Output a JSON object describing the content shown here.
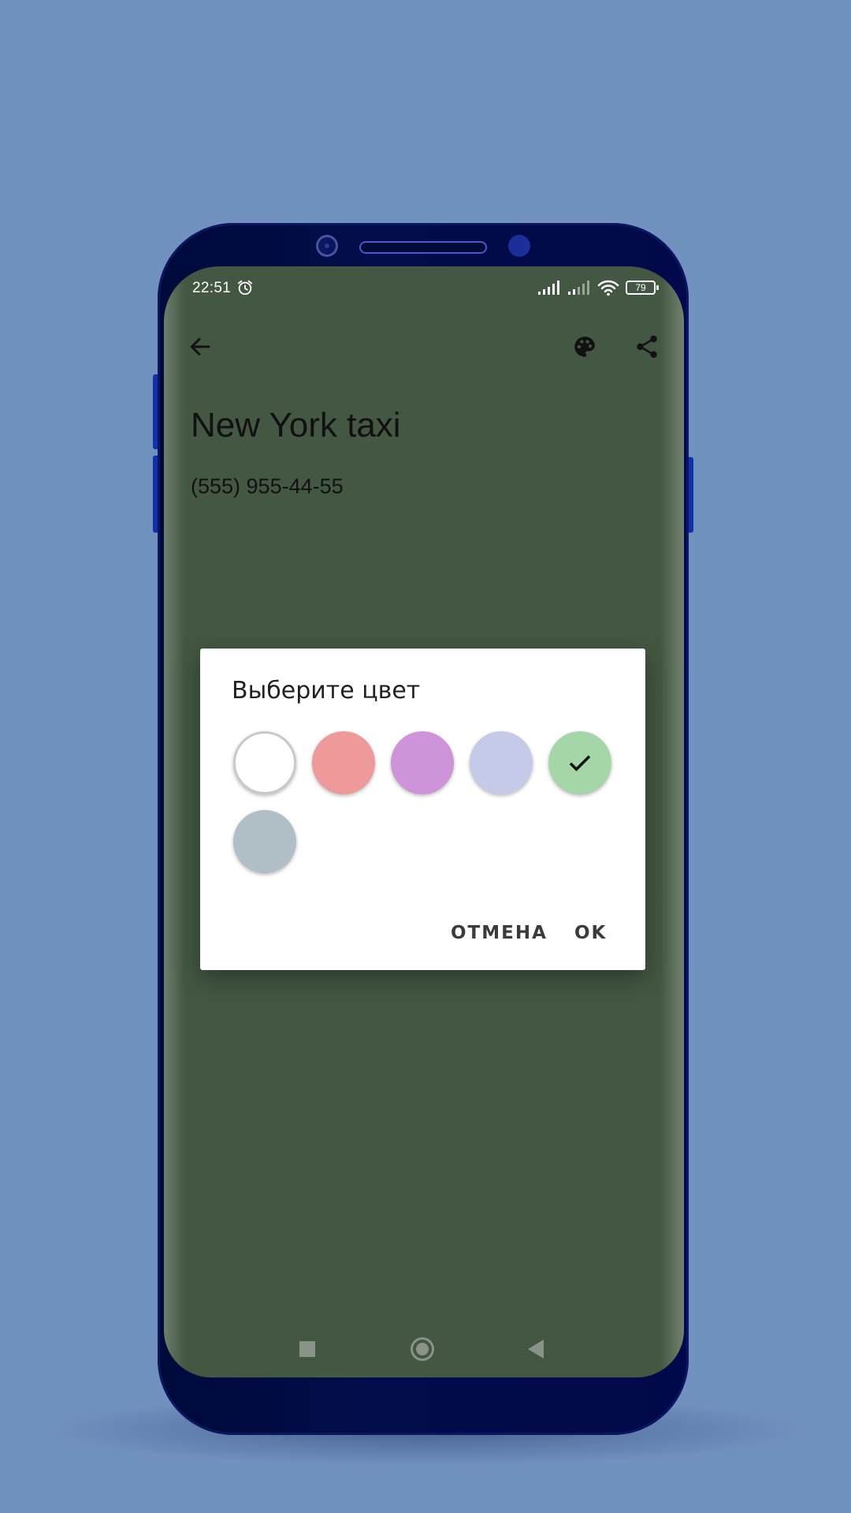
{
  "status_bar": {
    "time": "22:51",
    "battery": "79",
    "icons": [
      "alarm-icon",
      "signal-icon",
      "signal-icon",
      "wifi-icon",
      "battery-icon"
    ]
  },
  "app_bar": {
    "back_icon": "arrow-left-icon",
    "actions": [
      "palette-icon",
      "share-icon"
    ]
  },
  "note": {
    "title": "New York taxi",
    "phone": "(555) 955-44-55",
    "background_color": "#435742"
  },
  "dialog": {
    "title": "Выберите цвет",
    "colors": [
      {
        "name": "white",
        "hex": "#ffffff",
        "selected": false
      },
      {
        "name": "red",
        "hex": "#ef9a9a",
        "selected": false
      },
      {
        "name": "purple",
        "hex": "#ce93d8",
        "selected": false
      },
      {
        "name": "indigo",
        "hex": "#c5cae9",
        "selected": false
      },
      {
        "name": "green",
        "hex": "#a5d6a7",
        "selected": true
      },
      {
        "name": "blue-grey",
        "hex": "#b0bec5",
        "selected": false
      }
    ],
    "cancel_label": "ОТМЕНА",
    "ok_label": "OK"
  },
  "nav_bar": [
    "recents-button",
    "home-button",
    "back-button"
  ]
}
